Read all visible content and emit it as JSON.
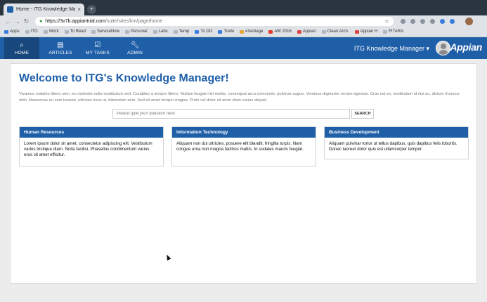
{
  "browser": {
    "tab_title": "Home - ITG Knowledge Manag",
    "tab_close": "×",
    "new_tab": "+",
    "url_host": "https://3v7b.appiantrial.com",
    "url_path": "/suite/sites/km/page/home",
    "bookmarks": [
      "Apps",
      "ITG",
      "Work",
      "To Read",
      "ServiceNow",
      "Personal",
      "Labs",
      "Temp",
      "To DO",
      "Trello",
      "eVantage",
      "AW 2016",
      "Appian",
      "Clean Arch.",
      "Appian H",
      "FITARA"
    ]
  },
  "appbar": {
    "nav": [
      {
        "label": "HOME",
        "icon": "search-icon"
      },
      {
        "label": "ARTICLES",
        "icon": "folder-icon"
      },
      {
        "label": "MY TASKS",
        "icon": "checkbox-icon"
      },
      {
        "label": "ADMIN",
        "icon": "wrench-icon"
      }
    ],
    "site_name": "ITG Knowledge Manager ▾",
    "brand": "Appian",
    "accent": "#1f5fa8"
  },
  "page": {
    "title": "Welcome to ITG's Knowledge Manager!",
    "intro": "Vivamus sodales libero sem, eu molestie nulla vestibulum sed. Curabitur a tempor libero. Nullam feugiat nisl mattis, consequat arcu commodo, pulvinar augue. Vivamus dignissim ornare egestas. Cras est ex, vestibulum id nisi ac, dictum rhoncus nibh. Maecenas eu sem laoreet, ultricies risus ut, bibendum sem. Sed sit amet tempor magna. Proin vel dolor sit amet diam varius aliquet.",
    "search_placeholder": "Please type your question here.",
    "search_button": "SEARCH",
    "cards": [
      {
        "title": "Human Resources",
        "body": "Lorem ipsum dolor sit amet, consectetur adipiscing elit. Vestibulum varius tristique diam. Nulla facilisi. Phasellus condimentum varius eros sit amet efficitur."
      },
      {
        "title": "Information Technology",
        "body": "Aliquam non dui ultricies, posuere elit blandit, fringilla turpis. Nam congue urna non magna facilisis mattis. In sodales mauris feugiat."
      },
      {
        "title": "Business Development",
        "body": "Aliquam pulvinar tortor ut tellus dapibus, quis dapibus felis lobortis. Donec laoreet dolor quis est ullamcorper tempor."
      }
    ]
  }
}
